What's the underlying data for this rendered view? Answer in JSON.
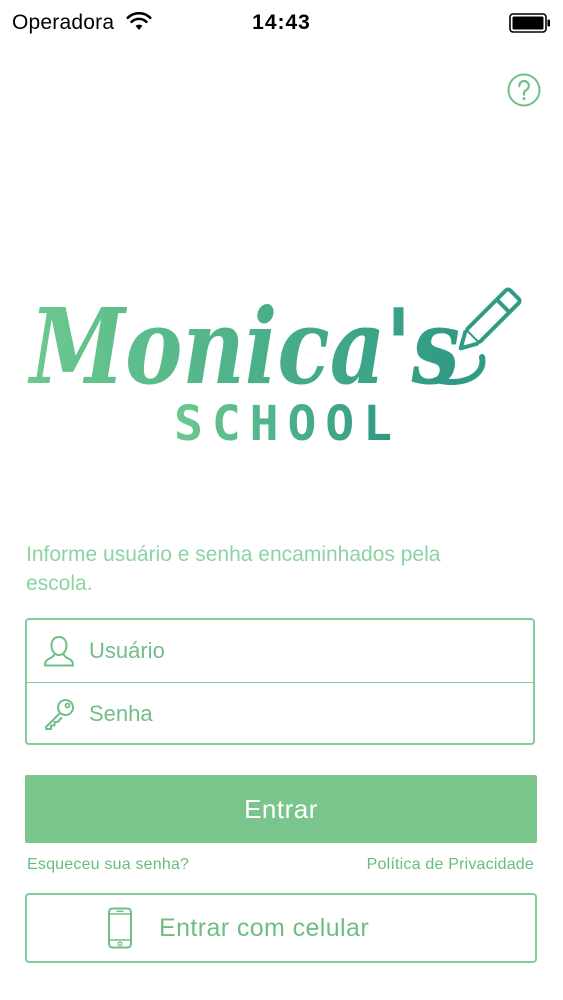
{
  "status_bar": {
    "carrier": "Operadora",
    "time": "14:43",
    "wifi_icon": "wifi-icon",
    "battery_icon": "battery-icon"
  },
  "header": {
    "help_icon": "question-circle-icon"
  },
  "logo": {
    "wordmark": "Monica's",
    "subtitle": "SCHOOL",
    "icon": "pencil-icon",
    "colors": {
      "start": "#6cc98e",
      "end": "#2f9a85"
    }
  },
  "login": {
    "instructions": "Informe usuário e senha encaminhados pela escola.",
    "username": {
      "placeholder": "Usuário",
      "value": "",
      "icon": "user-icon"
    },
    "password": {
      "placeholder": "Senha",
      "value": "",
      "icon": "key-icon"
    },
    "submit_label": "Entrar",
    "forgot_password": "Esqueceu sua senha?",
    "privacy_policy": "Política de Privacidade",
    "phone_login": {
      "label": "Entrar com celular",
      "icon": "smartphone-icon"
    }
  },
  "colors": {
    "accent": "#79c58b",
    "border": "#84cc97",
    "text_light": "#8cd2a2"
  }
}
